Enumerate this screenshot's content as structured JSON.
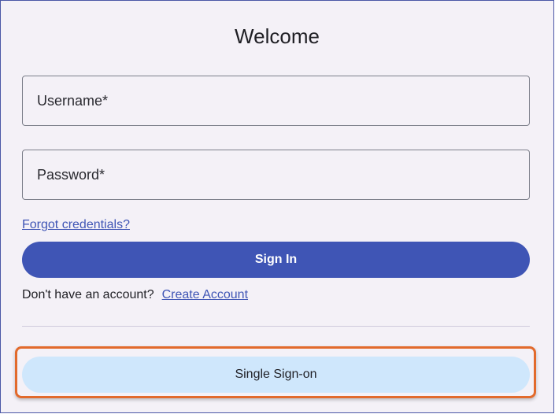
{
  "login": {
    "title": "Welcome",
    "username_placeholder": "Username*",
    "password_placeholder": "Password*",
    "forgot_link": "Forgot credentials?",
    "sign_in_label": "Sign In",
    "no_account_text": "Don't have an account?",
    "create_account_link": "Create Account",
    "sso_label": "Single Sign-on"
  },
  "colors": {
    "primary": "#3f55b5",
    "sso_background": "#cfe7fc",
    "highlight": "#e26a2c",
    "card_background": "#f4f1f7"
  }
}
